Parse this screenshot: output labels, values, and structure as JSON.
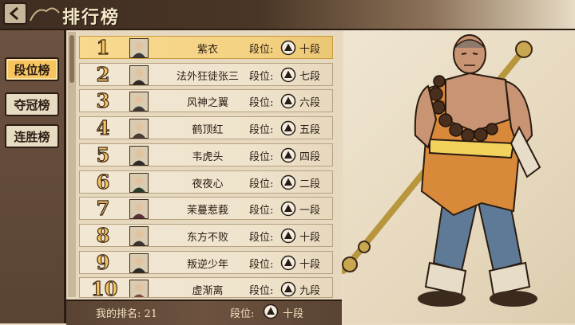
{
  "header": {
    "title": "排行榜",
    "back_icon": "back-arrow-icon"
  },
  "sidebar": {
    "tabs": [
      {
        "label": "段位榜",
        "active": true
      },
      {
        "label": "夺冠榜",
        "active": false
      },
      {
        "label": "连胜榜",
        "active": false
      }
    ]
  },
  "leaderboard": {
    "rank_label": "段位:",
    "rows": [
      {
        "rank": "1",
        "name": "紫衣",
        "tier": "十段",
        "active": true
      },
      {
        "rank": "2",
        "name": "法外狂徒张三",
        "tier": "七段",
        "active": false
      },
      {
        "rank": "3",
        "name": "风神之翼",
        "tier": "六段",
        "active": false
      },
      {
        "rank": "4",
        "name": "鹤顶红",
        "tier": "五段",
        "active": false
      },
      {
        "rank": "5",
        "name": "韦虎头",
        "tier": "四段",
        "active": false
      },
      {
        "rank": "6",
        "name": "夜夜心",
        "tier": "二段",
        "active": false
      },
      {
        "rank": "7",
        "name": "茉蔓惹莪",
        "tier": "一段",
        "active": false
      },
      {
        "rank": "8",
        "name": "东方不败",
        "tier": "十段",
        "active": false
      },
      {
        "rank": "9",
        "name": "叛逆少年",
        "tier": "十段",
        "active": false
      },
      {
        "rank": "10",
        "name": "虚渐离",
        "tier": "九段",
        "active": false
      }
    ]
  },
  "my_rank": {
    "text": "我的排名: 21",
    "tier_label": "段位:",
    "tier": "十段"
  },
  "colors": {
    "accent": "#f7c560",
    "dark": "#2a1c12",
    "panel": "#e6d9c0"
  }
}
